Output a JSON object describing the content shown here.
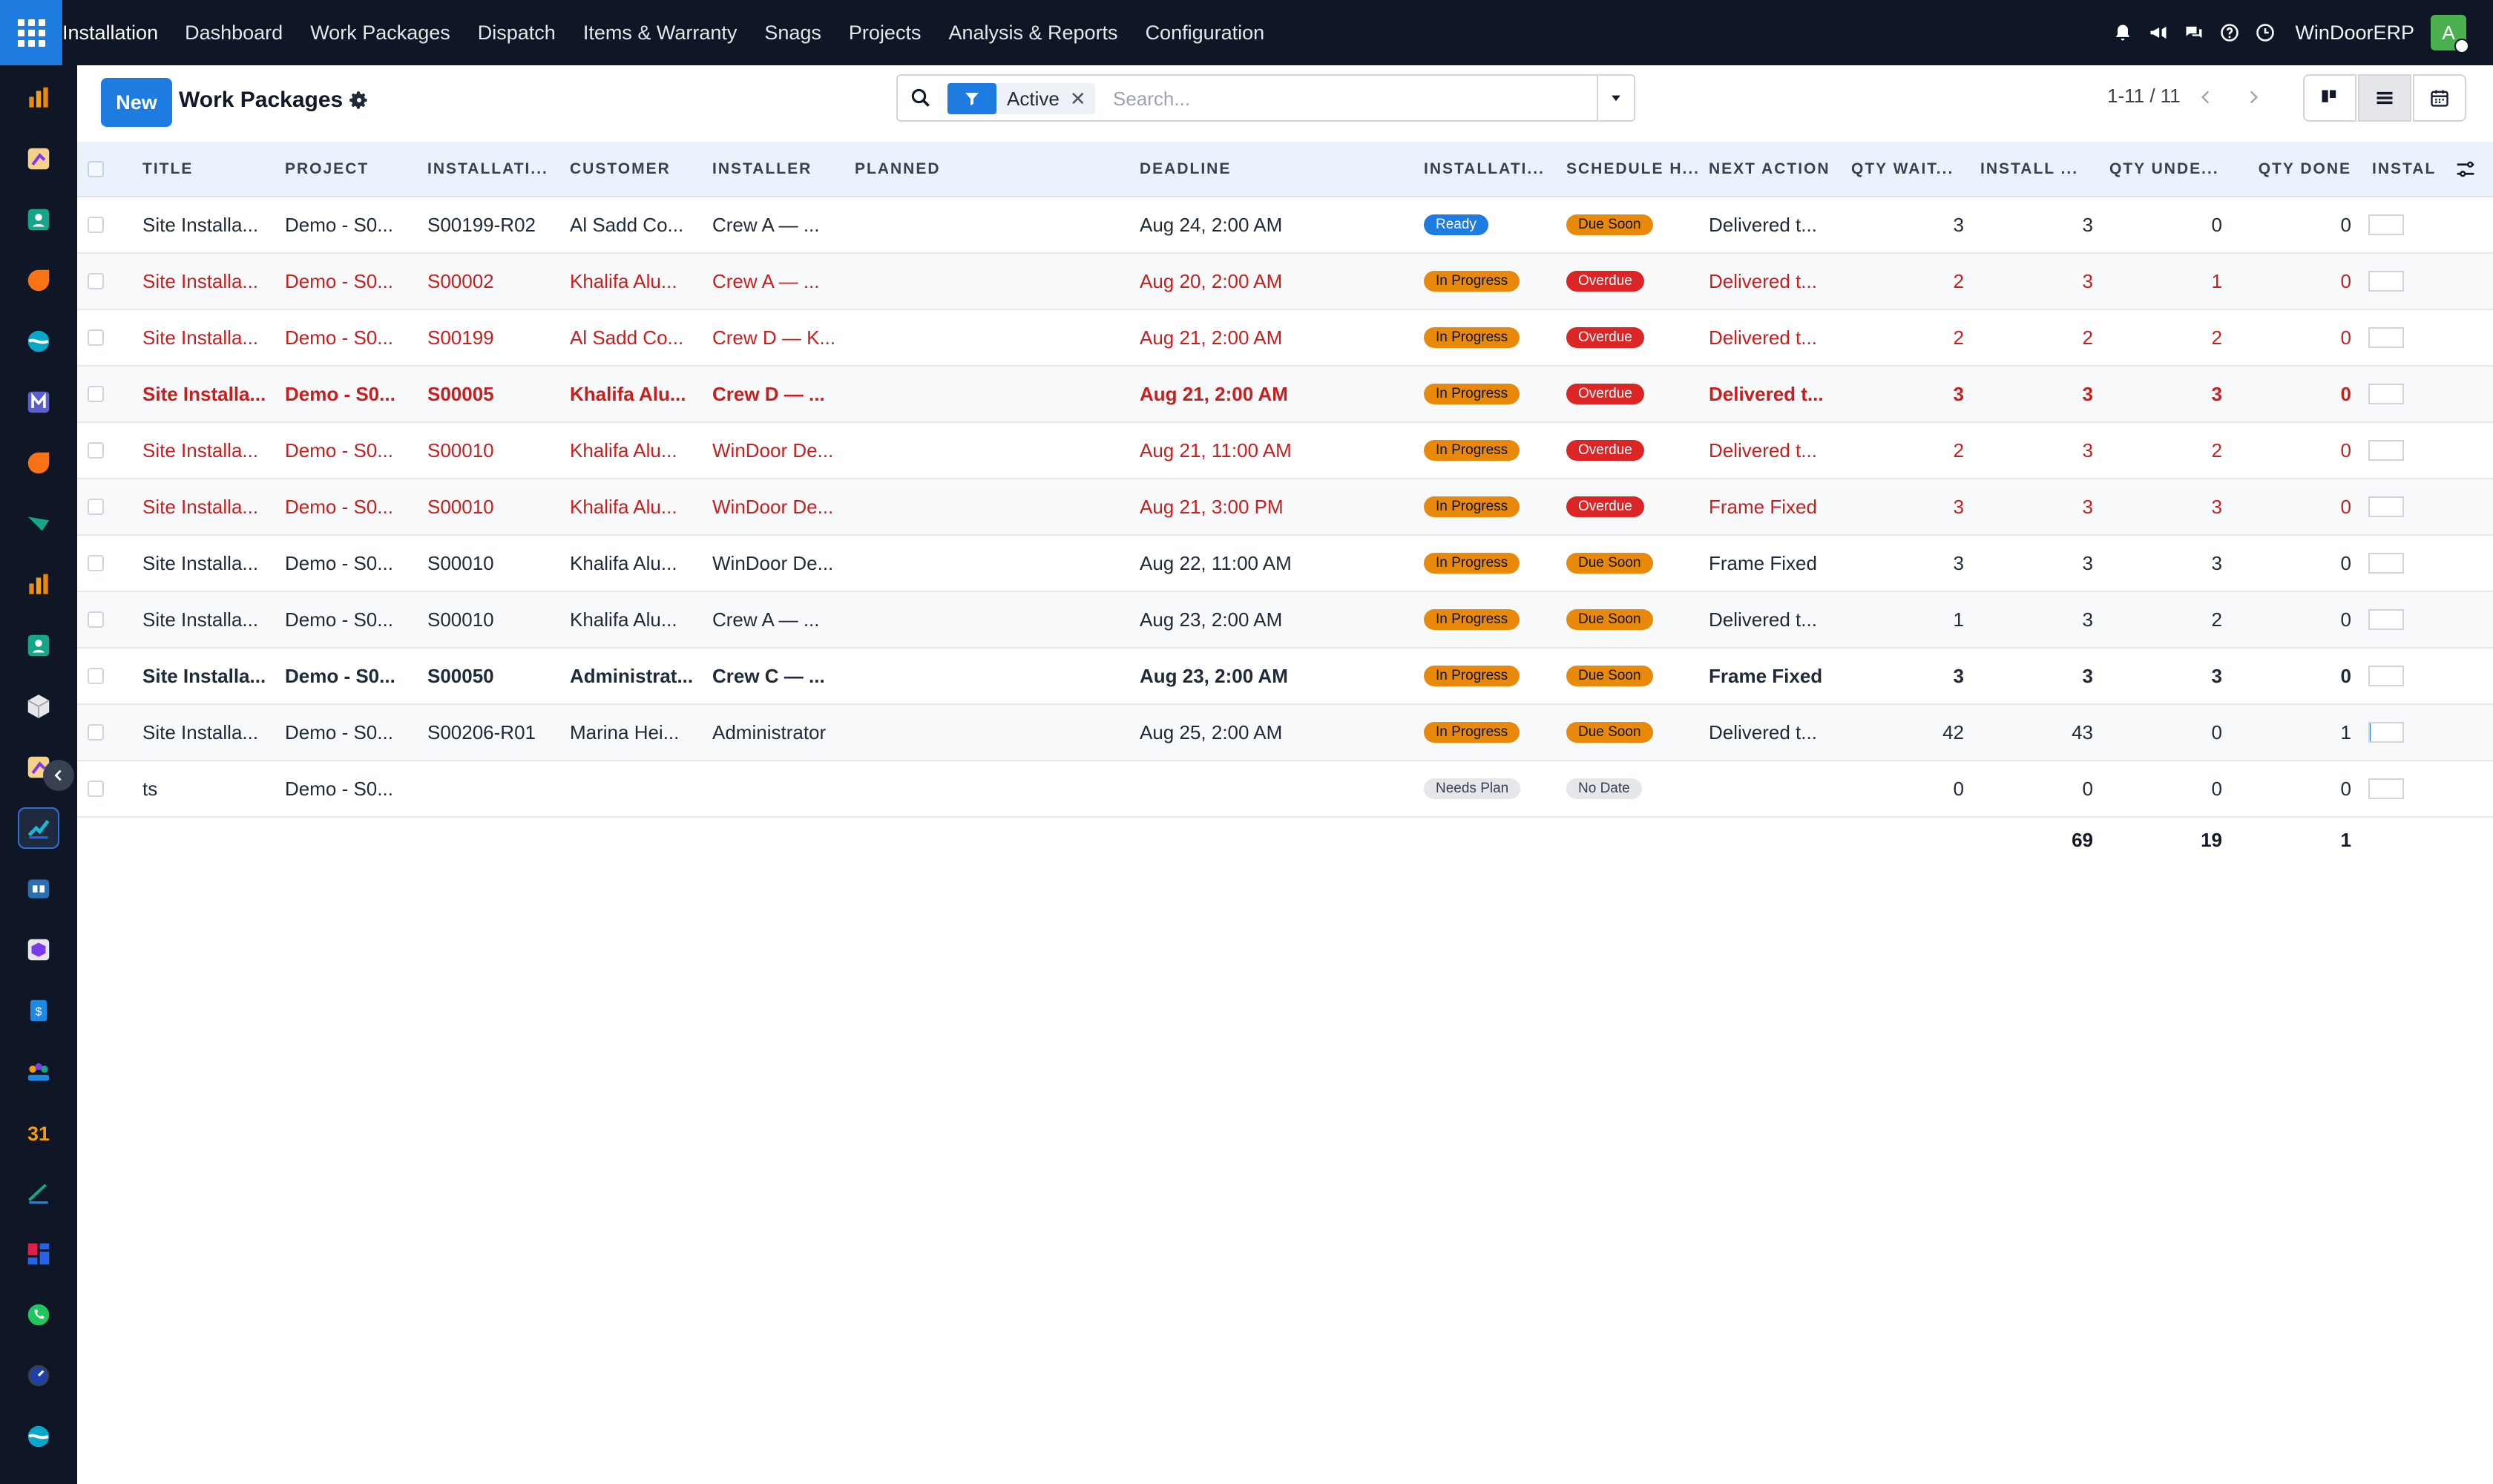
{
  "nav": {
    "app_name": "Installation",
    "menu": [
      "Dashboard",
      "Work Packages",
      "Dispatch",
      "Items & Warranty",
      "Snags",
      "Projects",
      "Analysis & Reports",
      "Configuration"
    ],
    "company": "WinDoorERP",
    "avatar_letter": "A",
    "icons": [
      "bell-icon",
      "megaphone-icon",
      "chat-icon",
      "help-icon",
      "clock-icon"
    ]
  },
  "sidebar": {
    "apps": [
      "reporting",
      "studio",
      "contacts",
      "discuss",
      "odoo-bi",
      "email-marketing",
      "live-chat",
      "sign",
      "documents",
      "employees",
      "inventory",
      "studio-2",
      "field-service",
      "knowledge",
      "barcode",
      "accounting",
      "employees-2",
      "calendar",
      "signature",
      "dashboards",
      "whatsapp",
      "timesheet",
      "website"
    ],
    "active_index": 12
  },
  "control": {
    "new_label": "New",
    "title": "Work Packages",
    "facet_label": "Active",
    "facet_remove": "✕",
    "search_placeholder": "Search...",
    "pager": "1-11 / 11"
  },
  "table": {
    "headers": {
      "title": "TITLE",
      "project": "PROJECT",
      "installation": "INSTALLATI...",
      "customer": "CUSTOMER",
      "installer": "INSTALLER",
      "planned": "PLANNED",
      "deadline": "DEADLINE",
      "install_state": "INSTALLATI...",
      "schedule": "SCHEDULE H...",
      "next_action": "NEXT ACTION",
      "qty_waiting": "QTY WAIT...",
      "install_qty": "INSTALL ...",
      "qty_under": "QTY UNDE...",
      "qty_done": "QTY DONE",
      "install_pct": "INSTAL"
    },
    "rows": [
      {
        "title": "Site Installa...",
        "project": "Demo - S0...",
        "installation": "S00199-R02",
        "customer": "Al Sadd Co...",
        "installer": "Crew A — ...",
        "planned": "",
        "deadline": "Aug 24, 2:00 AM",
        "state": "Ready",
        "state_kind": "ready",
        "schedule": "Due Soon",
        "schedule_kind": "due",
        "next_action": "Delivered t...",
        "qty_waiting": "3",
        "install_qty": "3",
        "qty_under": "0",
        "qty_done": "0",
        "pct": "0 %",
        "pct_value": 0,
        "style": "normal"
      },
      {
        "title": "Site Installa...",
        "project": "Demo - S0...",
        "installation": "S00002",
        "customer": "Khalifa Alu...",
        "installer": "Crew A — ...",
        "planned": "",
        "deadline": "Aug 20, 2:00 AM",
        "state": "In Progress",
        "state_kind": "prog",
        "schedule": "Overdue",
        "schedule_kind": "over",
        "next_action": "Delivered t...",
        "qty_waiting": "2",
        "install_qty": "3",
        "qty_under": "1",
        "qty_done": "0",
        "pct": "0 %",
        "pct_value": 0,
        "style": "red"
      },
      {
        "title": "Site Installa...",
        "project": "Demo - S0...",
        "installation": "S00199",
        "customer": "Al Sadd Co...",
        "installer": "Crew D — K...",
        "planned": "",
        "deadline": "Aug 21, 2:00 AM",
        "state": "In Progress",
        "state_kind": "prog",
        "schedule": "Overdue",
        "schedule_kind": "over",
        "next_action": "Delivered t...",
        "qty_waiting": "2",
        "install_qty": "2",
        "qty_under": "2",
        "qty_done": "0",
        "pct": "0 %",
        "pct_value": 0,
        "style": "red"
      },
      {
        "title": "Site Installa...",
        "project": "Demo - S0...",
        "installation": "S00005",
        "customer": "Khalifa Alu...",
        "installer": "Crew D — ...",
        "planned": "",
        "deadline": "Aug 21, 2:00 AM",
        "state": "In Progress",
        "state_kind": "prog",
        "schedule": "Overdue",
        "schedule_kind": "over",
        "next_action": "Delivered t...",
        "qty_waiting": "3",
        "install_qty": "3",
        "qty_under": "3",
        "qty_done": "0",
        "pct": "0 %",
        "pct_value": 0,
        "style": "red-bold"
      },
      {
        "title": "Site Installa...",
        "project": "Demo - S0...",
        "installation": "S00010",
        "customer": "Khalifa Alu...",
        "installer": "WinDoor De...",
        "planned": "",
        "deadline": "Aug 21, 11:00 AM",
        "state": "In Progress",
        "state_kind": "prog",
        "schedule": "Overdue",
        "schedule_kind": "over",
        "next_action": "Delivered t...",
        "qty_waiting": "2",
        "install_qty": "3",
        "qty_under": "2",
        "qty_done": "0",
        "pct": "0 %",
        "pct_value": 0,
        "style": "red"
      },
      {
        "title": "Site Installa...",
        "project": "Demo - S0...",
        "installation": "S00010",
        "customer": "Khalifa Alu...",
        "installer": "WinDoor De...",
        "planned": "",
        "deadline": "Aug 21, 3:00 PM",
        "state": "In Progress",
        "state_kind": "prog",
        "schedule": "Overdue",
        "schedule_kind": "over",
        "next_action": "Frame Fixed",
        "qty_waiting": "3",
        "install_qty": "3",
        "qty_under": "3",
        "qty_done": "0",
        "pct": "0 %",
        "pct_value": 0,
        "style": "red"
      },
      {
        "title": "Site Installa...",
        "project": "Demo - S0...",
        "installation": "S00010",
        "customer": "Khalifa Alu...",
        "installer": "WinDoor De...",
        "planned": "",
        "deadline": "Aug 22, 11:00 AM",
        "state": "In Progress",
        "state_kind": "prog",
        "schedule": "Due Soon",
        "schedule_kind": "due",
        "next_action": "Frame Fixed",
        "qty_waiting": "3",
        "install_qty": "3",
        "qty_under": "3",
        "qty_done": "0",
        "pct": "0 %",
        "pct_value": 0,
        "style": "normal"
      },
      {
        "title": "Site Installa...",
        "project": "Demo - S0...",
        "installation": "S00010",
        "customer": "Khalifa Alu...",
        "installer": "Crew A — ...",
        "planned": "",
        "deadline": "Aug 23, 2:00 AM",
        "state": "In Progress",
        "state_kind": "prog",
        "schedule": "Due Soon",
        "schedule_kind": "due",
        "next_action": "Delivered t...",
        "qty_waiting": "1",
        "install_qty": "3",
        "qty_under": "2",
        "qty_done": "0",
        "pct": "0 %",
        "pct_value": 0,
        "style": "normal"
      },
      {
        "title": "Site Installa...",
        "project": "Demo - S0...",
        "installation": "S00050",
        "customer": "Administrat...",
        "installer": "Crew C — ...",
        "planned": "",
        "deadline": "Aug 23, 2:00 AM",
        "state": "In Progress",
        "state_kind": "prog",
        "schedule": "Due Soon",
        "schedule_kind": "due",
        "next_action": "Frame Fixed",
        "qty_waiting": "3",
        "install_qty": "3",
        "qty_under": "3",
        "qty_done": "0",
        "pct": "0 %",
        "pct_value": 0,
        "style": "bold"
      },
      {
        "title": "Site Installa...",
        "project": "Demo - S0...",
        "installation": "S00206-R01",
        "customer": "Marina Hei...",
        "installer": "Administrator",
        "planned": "",
        "deadline": "Aug 25, 2:00 AM",
        "state": "In Progress",
        "state_kind": "prog",
        "schedule": "Due Soon",
        "schedule_kind": "due",
        "next_action": "Delivered t...",
        "qty_waiting": "42",
        "install_qty": "43",
        "qty_under": "0",
        "qty_done": "1",
        "pct": "2 %",
        "pct_value": 2,
        "style": "normal"
      },
      {
        "title": "ts",
        "project": "Demo - S0...",
        "installation": "",
        "customer": "",
        "installer": "",
        "planned": "",
        "deadline": "",
        "state": "Needs Plan",
        "state_kind": "gray",
        "schedule": "No Date",
        "schedule_kind": "gray",
        "next_action": "",
        "qty_waiting": "0",
        "install_qty": "0",
        "qty_under": "0",
        "qty_done": "0",
        "pct": "0 %",
        "pct_value": 0,
        "style": "normal"
      }
    ],
    "totals": {
      "install_qty": "69",
      "qty_under": "19",
      "qty_done": "1"
    }
  },
  "colors": {
    "brand": "#1e7be0",
    "navbar": "#0f1626",
    "overdue_text": "#c81e1e",
    "warning": "#e8890c",
    "danger": "#dc2626"
  }
}
